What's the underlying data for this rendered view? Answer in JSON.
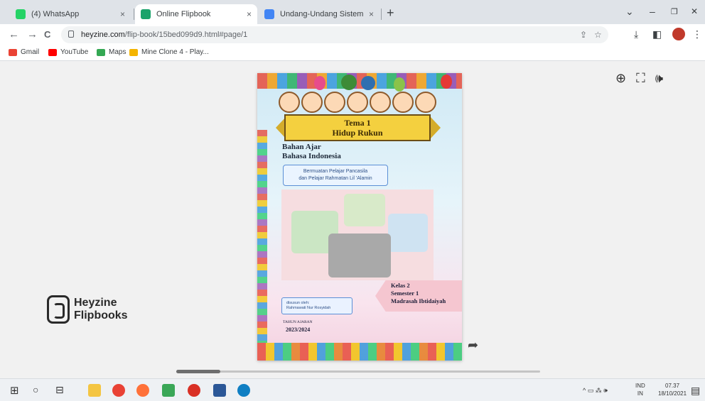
{
  "browser": {
    "tabs": [
      {
        "title": "(4) WhatsApp",
        "favicon_color": "#25d366",
        "active": false
      },
      {
        "title": "Online Flipbook",
        "favicon_color": "#1ba36b",
        "active": true
      },
      {
        "title": "Undang-Undang Sistem Pendid",
        "favicon_color": "#4285f4",
        "active": false
      }
    ],
    "new_tab_label": "+",
    "close_glyph": "×",
    "window_controls": {
      "dropdown": "⌄",
      "minimize": "–",
      "maximize": "❐",
      "close": "✕"
    },
    "url_host": "heyzine.com",
    "url_path": "/flip-book/15bed099d9.html#page/1",
    "nav": {
      "back": "←",
      "forward": "→",
      "reload": "C"
    },
    "toolbar_icons": {
      "share_page": "⇪",
      "bookmark_star": "☆",
      "download": "⤓",
      "sidepanel": "◧",
      "menu": "⋮"
    }
  },
  "bookmarks": [
    {
      "label": "Gmail",
      "color": "#ea4335"
    },
    {
      "label": "YouTube",
      "color": "#ff0000"
    },
    {
      "label": "Maps",
      "color": "#34a853"
    },
    {
      "label": "Mine Clone 4 - Play...",
      "color": "#f4b400"
    }
  ],
  "viewer": {
    "tools": {
      "zoom": "⊕",
      "fullscreen": "⛶",
      "sound": "🕪"
    },
    "brand_line1": "Heyzine",
    "brand_line2": "Flipbooks",
    "share_icon": "➦",
    "scroll_position": 0.12
  },
  "cover": {
    "theme_line1": "Tema 1",
    "theme_line2": "Hidup Rukun",
    "subject_line1": "Bahan Ajar",
    "subject_line2": "Bahasa Indonesia",
    "pill_line1": "Bermuatan Pelajar Pancasila",
    "pill_line2": "dan Pelajar Rahmatan Lil 'Alamin",
    "grade_line1": "Kelas 2",
    "grade_line2": "Semester 1",
    "grade_line3": "Madrasah Ibtidaiyah",
    "author_line1": "disusun oleh:",
    "author_line2": "Rahmawati Nur Rosyidah",
    "year_label": "TAHUN AJARAN",
    "year": "2023/2024"
  },
  "taskbar": {
    "start": "⊞",
    "search": "○",
    "task_view": "⊟",
    "apps": [
      {
        "name": "file-explorer",
        "color": "#f4c542"
      },
      {
        "name": "chrome",
        "color": "#e94235"
      },
      {
        "name": "firefox",
        "color": "#ff7139"
      },
      {
        "name": "paint",
        "color": "#3aa757"
      },
      {
        "name": "chrome-profile",
        "color": "#d93025"
      },
      {
        "name": "word",
        "color": "#2b5797"
      },
      {
        "name": "edge",
        "color": "#0f7fc3"
      }
    ],
    "tray": "^ ▭ ⁂ 🕪",
    "lang_line1": "IND",
    "lang_line2": "IN",
    "time": "07.37",
    "date": "18/10/2021",
    "notifications": "▤"
  }
}
